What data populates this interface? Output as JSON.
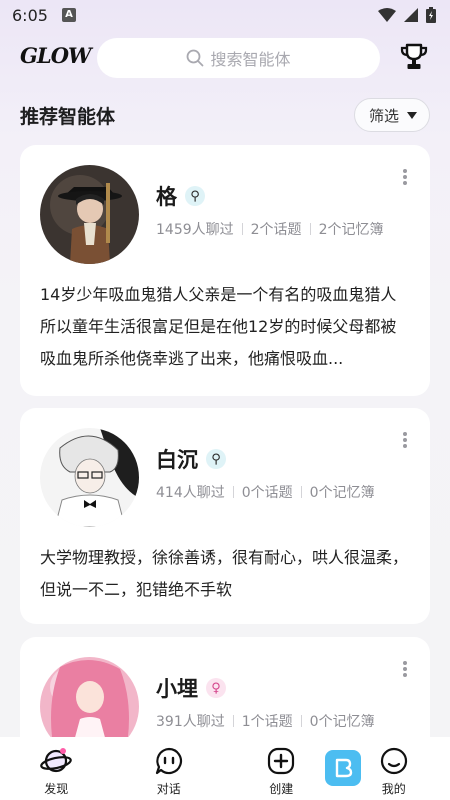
{
  "status_bar": {
    "time": "6:05",
    "notif_letter": "A"
  },
  "header": {
    "logo": "GLOW",
    "search_placeholder": "搜索智能体"
  },
  "section": {
    "title": "推荐智能体",
    "filter_label": "筛选"
  },
  "cards": [
    {
      "name": "格",
      "gender": "male",
      "gender_symbol": "⚲",
      "chats": "1459人聊过",
      "topics": "2个话题",
      "memories": "2个记忆簿",
      "desc": "14岁少年吸血鬼猎人父亲是一个有名的吸血鬼猎人所以童年生活很富足但是在他12岁的时候父母都被吸血鬼所杀他侥幸逃了出来，他痛恨吸血..."
    },
    {
      "name": "白沉",
      "gender": "male",
      "gender_symbol": "⚲",
      "chats": "414人聊过",
      "topics": "0个话题",
      "memories": "0个记忆簿",
      "desc": "大学物理教授，徐徐善诱，很有耐心，哄人很温柔，但说一不二，犯错绝不手软"
    },
    {
      "name": "小埋",
      "gender": "female",
      "gender_symbol": "♀",
      "chats": "391人聊过",
      "topics": "1个话题",
      "memories": "0个记忆簿",
      "desc": ""
    }
  ],
  "nav": [
    {
      "label": "发现",
      "icon": "planet-icon"
    },
    {
      "label": "对话",
      "icon": "chat-bubble-icon"
    },
    {
      "label": "创建",
      "icon": "plus-square-icon"
    },
    {
      "label": "我的",
      "icon": "profile-face-icon"
    }
  ],
  "colors": {
    "accent": "#d9ccf2",
    "male_badge": "#dff3f7",
    "female_badge": "#fbe3ef",
    "watermark": "#39b6f0"
  }
}
